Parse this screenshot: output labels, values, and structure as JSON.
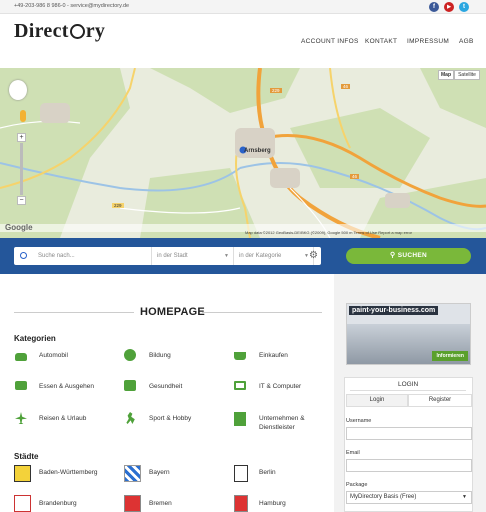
{
  "topbar": {
    "contact": "+49-203-986 8 986-0 - service@mydirectory.de",
    "social": [
      {
        "name": "facebook",
        "glyph": "f",
        "color": "#3b5998"
      },
      {
        "name": "youtube",
        "glyph": "▶",
        "color": "#cc2222"
      },
      {
        "name": "twitter",
        "glyph": "t",
        "color": "#2aa6e0"
      }
    ]
  },
  "header": {
    "logo_left": "Direct",
    "logo_right": "ry",
    "nav": [
      "ACCOUNT INFOS",
      "KONTAKT",
      "IMPRESSUM",
      "AGB"
    ]
  },
  "map": {
    "type_buttons": [
      "Map",
      "Satellite"
    ],
    "zoom_in": "+",
    "zoom_out": "−",
    "town_label": "Arnsberg",
    "road_labels": [
      "46",
      "229",
      "46",
      "229"
    ],
    "attribution": "Map data ©2012 GeoBasis-DE/BKG (©2009), Google   500 m    Terms of Use   Report a map error",
    "google": "Google"
  },
  "search": {
    "query_placeholder": "Suche nach...",
    "city_placeholder": "in der Stadt",
    "category_placeholder": "in der Kategorie",
    "button": "SUCHEN"
  },
  "main": {
    "title": "HOMEPAGE",
    "categories_heading": "Kategorien",
    "categories": [
      {
        "label": "Automobil",
        "icon": "car-icon"
      },
      {
        "label": "Bildung",
        "icon": "globe-icon"
      },
      {
        "label": "Einkaufen",
        "icon": "basket-icon"
      },
      {
        "label": "Essen & Ausgehen",
        "icon": "truck-icon"
      },
      {
        "label": "Gesundheit",
        "icon": "medkit-icon"
      },
      {
        "label": "IT & Computer",
        "icon": "laptop-icon"
      },
      {
        "label": "Reisen & Urlaub",
        "icon": "plane-icon"
      },
      {
        "label": "Sport & Hobby",
        "icon": "runner-icon"
      },
      {
        "label": "Unternehmen & Dienstleister",
        "icon": "building-icon"
      }
    ],
    "cities_heading": "Städte",
    "cities": [
      "Baden-Württemberg",
      "Bayern",
      "Berlin",
      "Brandenburg",
      "Bremen",
      "Hamburg"
    ]
  },
  "sidebar": {
    "ad_title": "paint-your-business.com",
    "ad_button": "Informieren",
    "login_title": "LOGIN",
    "tabs": [
      "Login",
      "Register"
    ],
    "username_label": "Username",
    "email_label": "Email",
    "package_label": "Package",
    "package_value": "MyDirectory Basis (Free)"
  },
  "colors": {
    "accent_green": "#7ab83a",
    "search_blue": "#24569a",
    "icon_green": "#4fa13a"
  }
}
